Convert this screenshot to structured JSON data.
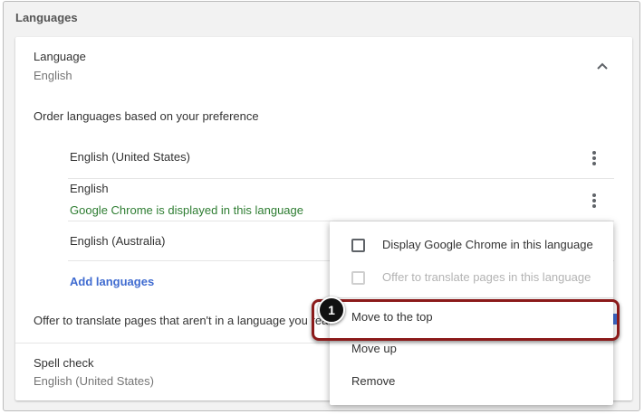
{
  "section": {
    "title": "Languages"
  },
  "language": {
    "label": "Language",
    "value": "English"
  },
  "order_text": "Order languages based on your preference",
  "languages": [
    {
      "name": "English (United States)"
    },
    {
      "name": "English",
      "note": "Google Chrome is displayed in this language"
    },
    {
      "name": "English (Australia)"
    }
  ],
  "add_languages_label": "Add languages",
  "offer_translate_text": "Offer to translate pages that aren't in a language you read",
  "spell_check": {
    "label": "Spell check",
    "value": "English (United States)"
  },
  "menu": {
    "display_chrome_label": "Display Google Chrome in this language",
    "offer_translate_label": "Offer to translate pages in this language",
    "move_to_top_label": "Move to the top",
    "move_up_label": "Move up",
    "remove_label": "Remove"
  },
  "annotation": {
    "step": "1"
  },
  "colors": {
    "accent_link": "#3f6bd0",
    "note_green": "#2e7d32",
    "highlight_border": "#8b1a1a",
    "badge_bg": "#111111"
  }
}
